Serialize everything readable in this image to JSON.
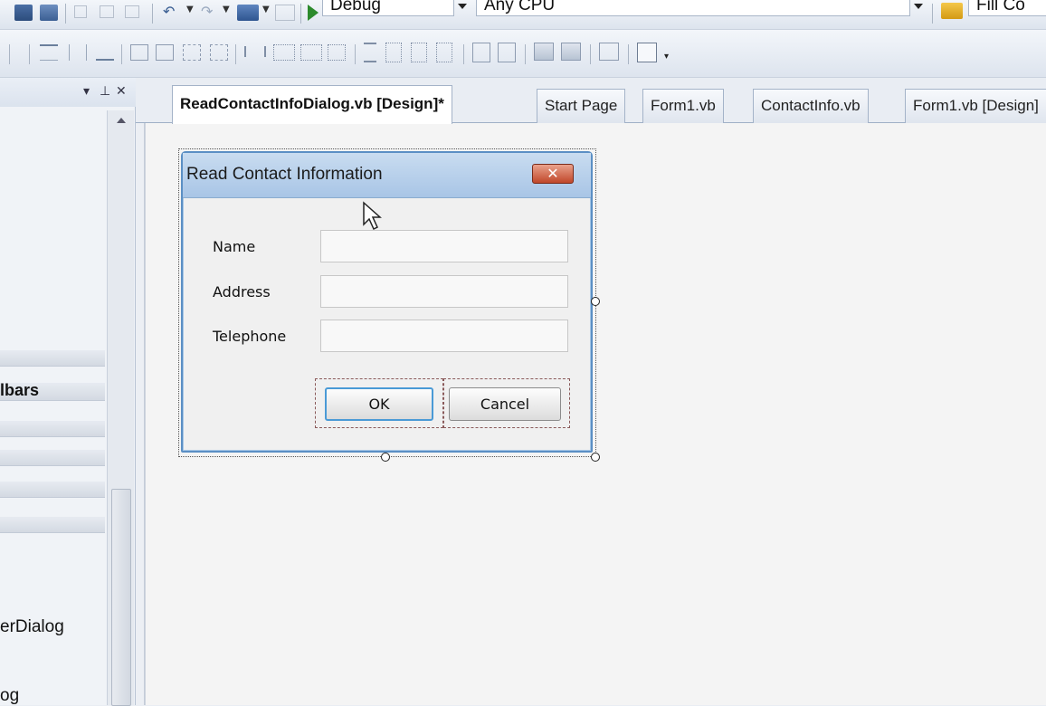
{
  "toolbar": {
    "config_combo": "Debug",
    "platform_combo": "Any CPU",
    "find_combo": "Fill Co"
  },
  "left_panel": {
    "items": [
      {
        "label": "lbars"
      },
      {
        "label": "erDialog"
      },
      {
        "label": "og"
      }
    ]
  },
  "tabs": [
    {
      "label": "ReadContactInfoDialog.vb [Design]*"
    },
    {
      "label": "Start Page"
    },
    {
      "label": "Form1.vb"
    },
    {
      "label": "ContactInfo.vb"
    },
    {
      "label": "Form1.vb [Design]"
    }
  ],
  "form": {
    "title": "Read Contact Information",
    "close_glyph": "✕",
    "fields": [
      {
        "label": "Name",
        "value": ""
      },
      {
        "label": "Address",
        "value": ""
      },
      {
        "label": "Telephone",
        "value": ""
      }
    ],
    "ok_label": "OK",
    "cancel_label": "Cancel"
  },
  "colors": {
    "titlebar": "#a8c5e6",
    "close_button": "#c0472a",
    "ok_focus": "#4a9ad6"
  }
}
